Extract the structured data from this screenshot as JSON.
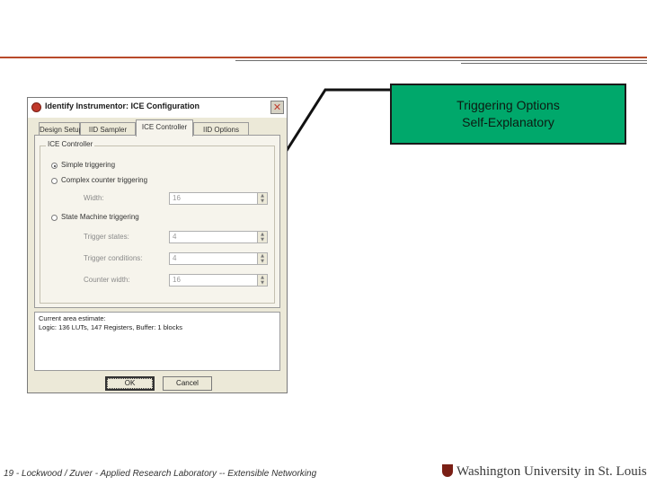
{
  "dialog": {
    "title": "Identify Instrumentor: ICE Configuration",
    "close_glyph": "✕",
    "tabs": [
      {
        "label": "Design Setup"
      },
      {
        "label": "IID Sampler"
      },
      {
        "label": "ICE Controller"
      },
      {
        "label": "IID Options"
      }
    ],
    "group_title": "ICE Controller",
    "options": [
      {
        "label": "Simple triggering",
        "selected": true
      },
      {
        "label": "Complex counter triggering",
        "selected": false
      },
      {
        "label": "State Machine triggering",
        "selected": false
      }
    ],
    "fields": {
      "width": {
        "label": "Width:",
        "value": "16"
      },
      "trigger_states": {
        "label": "Trigger states:",
        "value": "4"
      },
      "trigger_conditions": {
        "label": "Trigger conditions:",
        "value": "4"
      },
      "counter_width": {
        "label": "Counter width:",
        "value": "16"
      }
    },
    "estimate": {
      "line1": "Current area estimate:",
      "line2": "Logic: 136 LUTs, 147 Registers, Buffer: 1 blocks"
    },
    "buttons": {
      "ok": "OK",
      "cancel": "Cancel"
    }
  },
  "callout": {
    "line1": "Triggering Options",
    "line2": "Self-Explanatory"
  },
  "footer": {
    "text": "19 - Lockwood / Zuver - Applied Research Laboratory -- Extensible Networking",
    "logo_text": "Washington University in St. Louis"
  },
  "colors": {
    "callout_bg": "#00a86b",
    "accent_rule": "#b84a2a"
  }
}
